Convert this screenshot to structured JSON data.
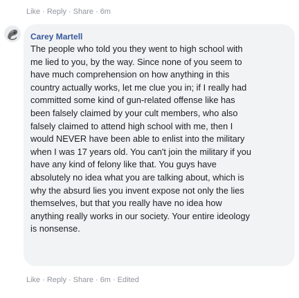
{
  "prev_comment": {
    "actions": {
      "like": "Like",
      "reply": "Reply",
      "share": "Share",
      "time": "6m"
    }
  },
  "comment": {
    "author": "Carey Martell",
    "avatar_icon": "user-avatar-icon",
    "text": "The people who told you they went to high school with me lied to you, by the way. Since none of you seem to have much comprehension on how anything in this country actually works, let me clue you in; if I really had committed some kind of gun-related offense like has been falsely claimed by your cult members, who also falsely claimed to attend high school with me, then I would NEVER have been able to enlist into the military when I was 17 years old. You can't join the military if you have any kind of felony like that. You guys have absolutely no idea what you are talking about, which is why the absurd lies you invent expose not only the lies themselves, but that you really have no idea how anything really works in our society. Your entire ideology is nonsense.",
    "actions": {
      "like": "Like",
      "reply": "Reply",
      "share": "Share",
      "time": "6m",
      "edited": "Edited"
    }
  },
  "colors": {
    "author": "#365899",
    "meta": "#90949c",
    "bubble": "#f2f3f5",
    "text": "#1c1e21"
  }
}
